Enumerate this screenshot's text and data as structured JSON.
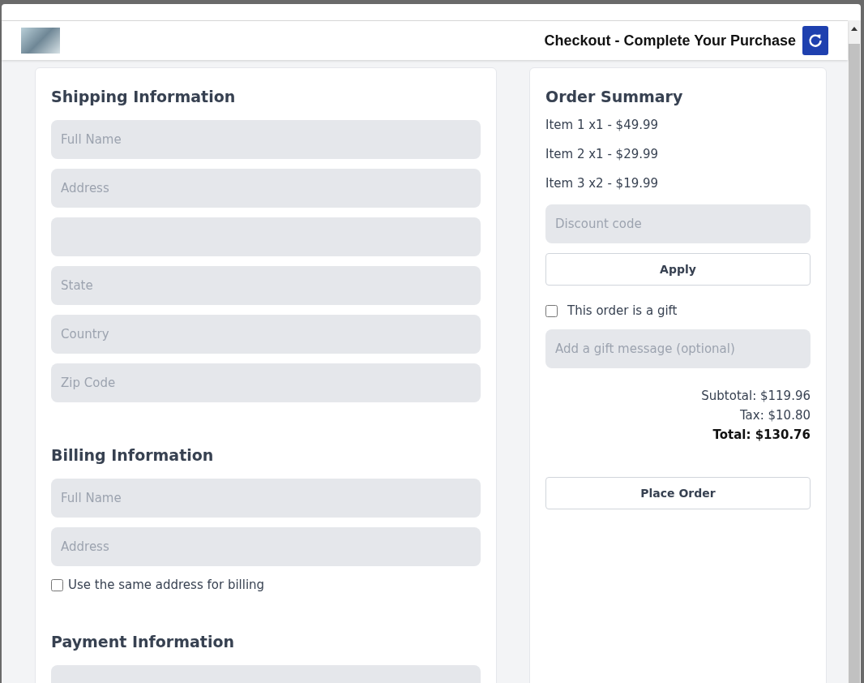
{
  "header": {
    "title": "Checkout - Complete Your Purchase"
  },
  "shipping": {
    "title": "Shipping Information",
    "fields": [
      {
        "kind": "text",
        "placeholder": "Full Name"
      },
      {
        "kind": "text",
        "placeholder": "Address"
      },
      {
        "kind": "text"
      },
      {
        "kind": "text",
        "placeholder": "State"
      },
      {
        "kind": "text",
        "placeholder": "Country"
      },
      {
        "kind": "text",
        "placeholder": "Zip Code"
      }
    ]
  },
  "billing": {
    "title": "Billing Information",
    "fields": [
      {
        "kind": "text",
        "placeholder": "Full Name"
      },
      {
        "kind": "text",
        "placeholder": "Address"
      }
    ],
    "same_address": {
      "label": "Use the same address for billing",
      "checked": false
    }
  },
  "payment": {
    "title": "Payment Information",
    "fields": [
      {
        "kind": "text"
      }
    ]
  },
  "summary": {
    "title": "Order Summary",
    "items": [
      "Item 1 x1 - $49.99",
      "Item 2 x1 - $29.99",
      "Item 3 x2 - $19.99"
    ],
    "discount": {
      "placeholder": "Discount code"
    },
    "apply_button": "Apply",
    "gift": {
      "label": "This order is a gift",
      "checked": false
    },
    "gift_message": {
      "placeholder": "Add a gift message (optional)"
    },
    "subtotal": "Subtotal: $119.96",
    "tax": "Tax: $10.80",
    "total": "Total: $130.76",
    "place_order_button": "Place Order"
  }
}
